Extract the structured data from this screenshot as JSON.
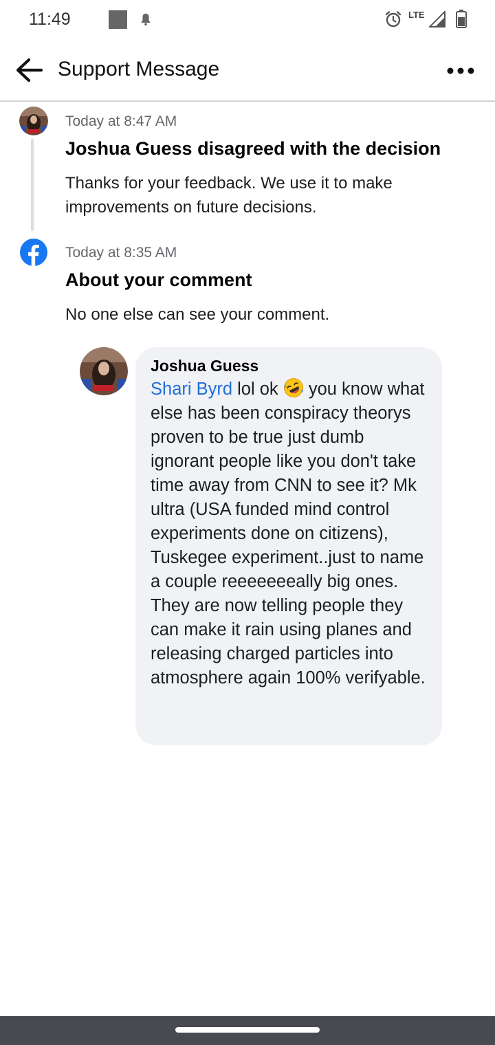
{
  "status_bar": {
    "time": "11:49",
    "network": "LTE"
  },
  "app_bar": {
    "title": "Support Message",
    "back_icon": "arrow-left-icon",
    "more_icon": "more-horizontal-icon"
  },
  "events": [
    {
      "timestamp": "Today at 8:47 AM",
      "title": "Joshua Guess disagreed with the decision",
      "body": "Thanks for your feedback. We use it to make improvements on future decisions.",
      "icon": "user-avatar"
    },
    {
      "timestamp": "Today at 8:35 AM",
      "title": "About your comment",
      "body": "No one else can see your comment.",
      "icon": "facebook-icon"
    }
  ],
  "comment": {
    "author": "Joshua Guess",
    "mention": "Shari Byrd",
    "text_before_emoji": " lol ok ",
    "text_after_emoji": " you know what else has been conspiracy theorys proven to be true just dumb ignorant people like you don't take time away from CNN to see it? Mk ultra (USA funded mind control experiments done on citizens), Tuskegee experiment..just to name a couple reeeeeeeally big ones. They are now telling people they can make it rain using planes and releasing charged particles into atmosphere again 100% verifyable.",
    "emoji": "rolling-on-floor-laughing-emoji"
  },
  "colors": {
    "link": "#216fdb",
    "facebook_blue": "#1877f2",
    "bubble_bg": "#f0f2f5",
    "secondary_text": "#65676b",
    "nav_bar": "#474a4f"
  }
}
